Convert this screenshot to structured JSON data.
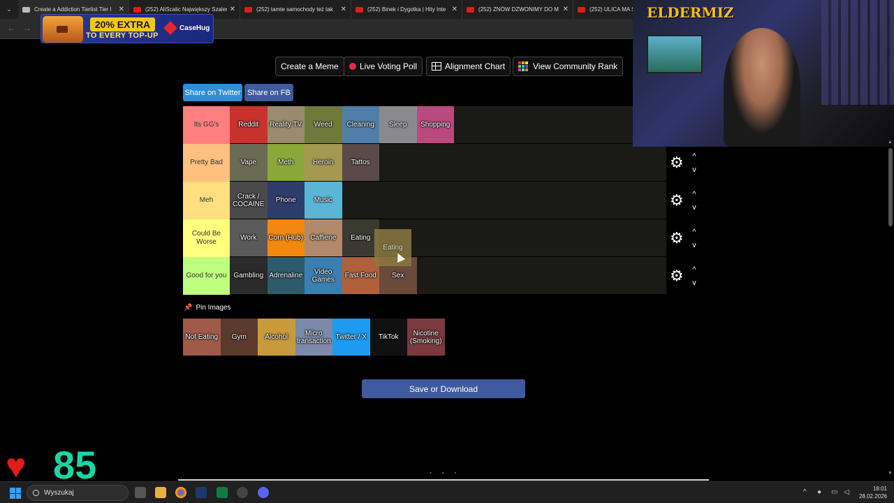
{
  "browser": {
    "tabs": [
      {
        "label": "Create a Addiction Tierlist Tier l",
        "active": true
      },
      {
        "label": "(252) AliScalic Największy Szaleń",
        "active": false
      },
      {
        "label": "(252) tamte samochody też tak",
        "active": false
      },
      {
        "label": "(252) Binek i Dygotka | Hity Inte",
        "active": false
      },
      {
        "label": "(252) ZNÓW DZWONIMY DO M",
        "active": false
      },
      {
        "label": "(252) ULICA MA SI",
        "active": false
      }
    ],
    "close_glyph": "✕"
  },
  "ad": {
    "headline": "20% EXTRA",
    "subline": "TO EVERY TOP-UP",
    "brand": "CaseHug"
  },
  "toolbar": {
    "create_meme": "Create a Meme",
    "live_poll": "Live Voting Poll",
    "alignment_chart": "Alignment Chart",
    "community_rank": "View Community Rank"
  },
  "share": {
    "twitter": "Share on Twitter",
    "fb": "Share on FB"
  },
  "tiers": [
    {
      "label": "Its GG's",
      "color": "#ff7f7f",
      "items": [
        {
          "label": "Reddit",
          "bg": "#c9322c"
        },
        {
          "label": "Reality TV",
          "bg": "#9a8a6e"
        },
        {
          "label": "Weed",
          "bg": "#6f7a3a"
        },
        {
          "label": "Cleaning",
          "bg": "#4f7fa8"
        },
        {
          "label": "Sleep",
          "bg": "#8a8a8c"
        },
        {
          "label": "Shopping",
          "bg": "#b84a7d"
        }
      ]
    },
    {
      "label": "Pretty Bad",
      "color": "#ffbf7f",
      "items": [
        {
          "label": "Vape",
          "bg": "#6b6b55"
        },
        {
          "label": "Meth",
          "bg": "#8aa83a"
        },
        {
          "label": "Heroin",
          "bg": "#a59850"
        },
        {
          "label": "Tattos",
          "bg": "#5a4a4a"
        }
      ]
    },
    {
      "label": "Meh",
      "color": "#ffdf7f",
      "items": [
        {
          "label": "Crack / COCAINE",
          "bg": "#4a4a4a"
        },
        {
          "label": "Phone",
          "bg": "#2d3c6a"
        },
        {
          "label": "Music",
          "bg": "#5bb6d6"
        }
      ]
    },
    {
      "label": "Could Be Worse",
      "color": "#ffff7f",
      "items": [
        {
          "label": "Work",
          "bg": "#5a5a5a"
        },
        {
          "label": "Corn (Hub)",
          "bg": "#f2880f"
        },
        {
          "label": "Caffiene",
          "bg": "#b08a6a"
        },
        {
          "label": "Eating",
          "bg": "#3a3a30"
        }
      ]
    },
    {
      "label": "Good for you",
      "color": "#bfff7f",
      "items": [
        {
          "label": "Gambling",
          "bg": "#2a2a2a"
        },
        {
          "label": "Adrenaline",
          "bg": "#2e5a6a"
        },
        {
          "label": "Video Games",
          "bg": "#3a7fb0"
        },
        {
          "label": "Fast Food",
          "bg": "#b0603a"
        },
        {
          "label": "Sex",
          "bg": "#6a4a3a"
        }
      ]
    }
  ],
  "drag_item": {
    "label": "Eating",
    "bg": "#8a7a40"
  },
  "icons": {
    "gear": "⚙",
    "up": "^",
    "down": "v",
    "pin": "📌",
    "heart": "♥"
  },
  "pin": {
    "title": "Pin Images",
    "items": [
      {
        "label": "Not Eating",
        "bg": "#a05a4a"
      },
      {
        "label": "Gym",
        "bg": "#5a3a2a"
      },
      {
        "label": "Alcohol",
        "bg": "#c89a3a"
      },
      {
        "label": "Micro transaction",
        "bg": "#7a8aa8"
      },
      {
        "label": "Twitter / X",
        "bg": "#1d9bf0"
      },
      {
        "label": "TikTok",
        "bg": "#111111"
      },
      {
        "label": "Nicotine (Smoking)",
        "bg": "#7a3a40"
      }
    ]
  },
  "save": {
    "label": "Save or Download"
  },
  "stream": {
    "streamer": "ELDERMIZ",
    "likes": "85"
  },
  "taskbar": {
    "search": "Wyszukaj",
    "time": "18:01",
    "date": "28.02.2026"
  }
}
